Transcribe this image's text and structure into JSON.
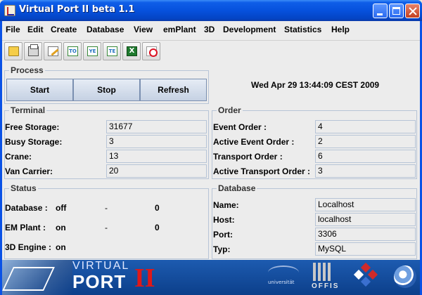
{
  "window": {
    "title": "Virtual Port II beta 1.1"
  },
  "menu": [
    "File",
    "Edit",
    "Create",
    "Database",
    "View",
    "emPlant",
    "3D",
    "Development",
    "Statistics",
    "Help"
  ],
  "toolbar": {
    "icons": [
      "open-folder-icon",
      "print-icon",
      "edit-icon",
      "to-icon",
      "ye-icon",
      "te-icon",
      "excel-icon",
      "pdf-icon"
    ],
    "glyphs": {
      "to": "TO",
      "ye": "YE",
      "te": "TE",
      "excel": "X"
    }
  },
  "process": {
    "title": "Process",
    "start_label": "Start",
    "stop_label": "Stop",
    "refresh_label": "Refresh",
    "datetime": "Wed Apr 29 13:44:09 CEST 2009"
  },
  "terminal": {
    "title": "Terminal",
    "rows": [
      {
        "label": "Free Storage:",
        "value": "31677"
      },
      {
        "label": "Busy Storage:",
        "value": "3"
      },
      {
        "label": "Crane:",
        "value": "13"
      },
      {
        "label": "Van Carrier:",
        "value": "20"
      }
    ]
  },
  "order": {
    "title": "Order",
    "rows": [
      {
        "label": "Event Order :",
        "value": "4"
      },
      {
        "label": "Active Event Order :",
        "value": "2"
      },
      {
        "label": "Transport Order :",
        "value": "6"
      },
      {
        "label": "Active Transport Order :",
        "value": "3"
      }
    ]
  },
  "status": {
    "title": "Status",
    "rows": [
      {
        "label": "Database :",
        "state": "off",
        "dash": "-",
        "count": "0"
      },
      {
        "label": "EM Plant :",
        "state": "on",
        "dash": "-",
        "count": "0"
      },
      {
        "label": "3D Engine :",
        "state": "on",
        "dash": "",
        "count": ""
      }
    ]
  },
  "database": {
    "title": "Database",
    "rows": [
      {
        "label": "Name:",
        "value": "Localhost"
      },
      {
        "label": "Host:",
        "value": "localhost"
      },
      {
        "label": "Port:",
        "value": "3306"
      },
      {
        "label": "Typ:",
        "value": "MySQL"
      }
    ]
  },
  "footer": {
    "brand_top": "VIRTUAL",
    "brand_main": "PORT",
    "brand_suffix": "II",
    "university_text": "universität",
    "offis_text": "OFFIS"
  },
  "colors": {
    "title_blue": "#0651dd",
    "panel_border": "#b7c4d6",
    "brand_red": "#e01818",
    "footer_blue": "#1d5bb0"
  }
}
